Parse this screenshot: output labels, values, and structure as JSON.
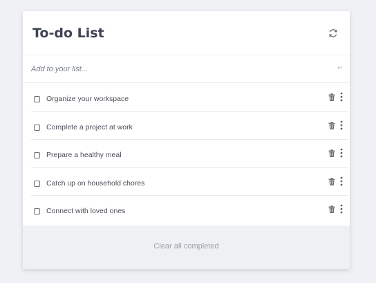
{
  "header": {
    "title": "To-do List",
    "refresh_icon": "refresh-icon"
  },
  "add_input": {
    "placeholder": "Add to your list...",
    "value": "",
    "enter_icon": "↵"
  },
  "items": [
    {
      "label": "Organize your workspace",
      "checked": false
    },
    {
      "label": "Complete a project at work",
      "checked": false
    },
    {
      "label": "Prepare a healthy meal",
      "checked": false
    },
    {
      "label": "Catch up on household chores",
      "checked": false
    },
    {
      "label": "Connect with loved ones",
      "checked": false
    }
  ],
  "footer": {
    "clear_label": "Clear all completed"
  },
  "colors": {
    "background": "#f0f1f4",
    "card": "#ffffff",
    "title": "#3f4452",
    "footer": "#eff0f3",
    "icon": "#6b6f77"
  }
}
